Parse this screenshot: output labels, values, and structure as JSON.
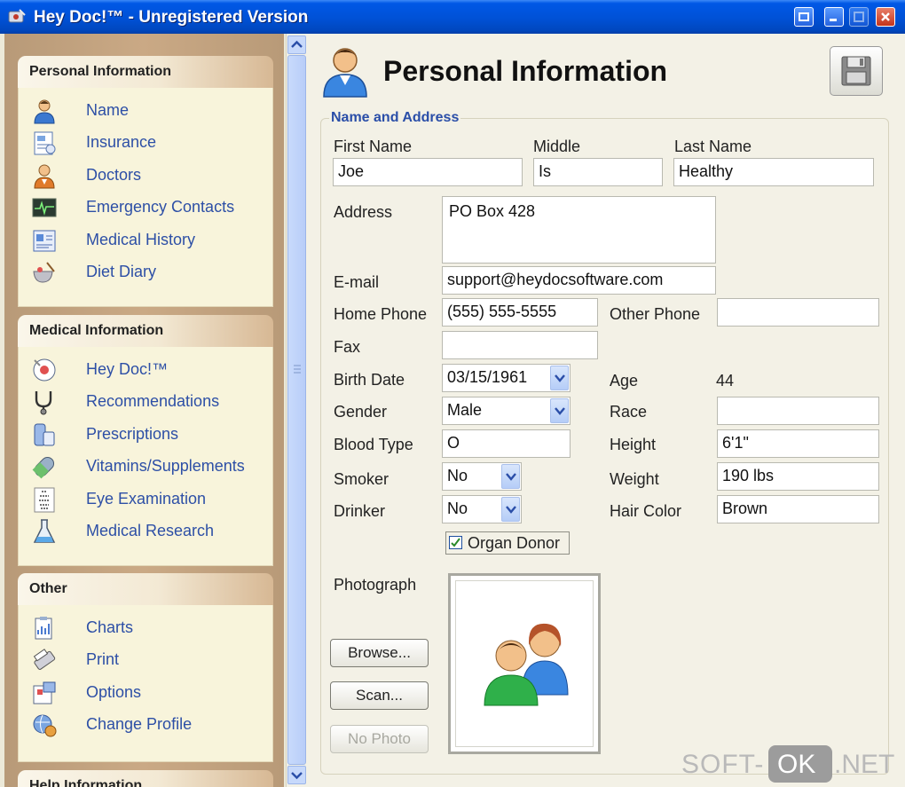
{
  "window": {
    "title": "Hey Doc!™ - Unregistered Version"
  },
  "nav": {
    "groups": [
      {
        "title": "Personal Information",
        "items": [
          {
            "label": "Name",
            "icon": "person-icon"
          },
          {
            "label": "Insurance",
            "icon": "insurance-card-icon"
          },
          {
            "label": "Doctors",
            "icon": "doctor-icon"
          },
          {
            "label": "Emergency Contacts",
            "icon": "heart-monitor-icon"
          },
          {
            "label": "Medical History",
            "icon": "medical-chart-icon"
          },
          {
            "label": "Diet Diary",
            "icon": "diet-bowl-icon"
          }
        ]
      },
      {
        "title": "Medical Information",
        "items": [
          {
            "label": "Hey Doc!™",
            "icon": "hey-doc-icon"
          },
          {
            "label": "Recommendations",
            "icon": "stethoscope-icon"
          },
          {
            "label": "Prescriptions",
            "icon": "prescription-icon"
          },
          {
            "label": "Vitamins/Supplements",
            "icon": "pill-icon"
          },
          {
            "label": "Eye Examination",
            "icon": "eye-chart-icon"
          },
          {
            "label": "Medical Research",
            "icon": "flask-icon"
          }
        ]
      },
      {
        "title": "Other",
        "items": [
          {
            "label": "Charts",
            "icon": "clipboard-chart-icon"
          },
          {
            "label": "Print",
            "icon": "printer-icon"
          },
          {
            "label": "Options",
            "icon": "options-icon"
          },
          {
            "label": "Change Profile",
            "icon": "profile-globe-icon"
          }
        ]
      },
      {
        "title": "Help Information",
        "items": []
      }
    ]
  },
  "main": {
    "title": "Personal Information",
    "section_title": "Name and Address",
    "labels": {
      "first_name": "First Name",
      "middle": "Middle",
      "last_name": "Last Name",
      "address": "Address",
      "email": "E-mail",
      "home_phone": "Home Phone",
      "other_phone": "Other Phone",
      "fax": "Fax",
      "birth_date": "Birth Date",
      "age": "Age",
      "gender": "Gender",
      "race": "Race",
      "blood_type": "Blood Type",
      "height": "Height",
      "smoker": "Smoker",
      "weight": "Weight",
      "drinker": "Drinker",
      "hair_color": "Hair Color",
      "photograph": "Photograph"
    },
    "values": {
      "first_name": "Joe",
      "middle": "Is",
      "last_name": "Healthy",
      "address": "PO Box 428",
      "email": "support@heydocsoftware.com",
      "home_phone": "(555) 555-5555",
      "other_phone": "",
      "fax": "",
      "birth_date": "03/15/1961",
      "age": "44",
      "gender": "Male",
      "race": "",
      "blood_type": "O",
      "height": "6'1\"",
      "smoker": "No",
      "weight": "190 lbs",
      "drinker": "No",
      "hair_color": "Brown"
    },
    "organ_donor": {
      "label": "Organ Donor",
      "checked": true
    },
    "buttons": {
      "browse": "Browse...",
      "scan": "Scan...",
      "no_photo": "No Photo"
    }
  },
  "watermark": {
    "part1": "SOFT-",
    "part2": "OK",
    "part3": ".NET"
  },
  "colors": {
    "titlebar": "#0055e5",
    "nav_link": "#2d4fa6",
    "section_title": "#2a4ea8",
    "nav_panel": "#c4a480"
  }
}
